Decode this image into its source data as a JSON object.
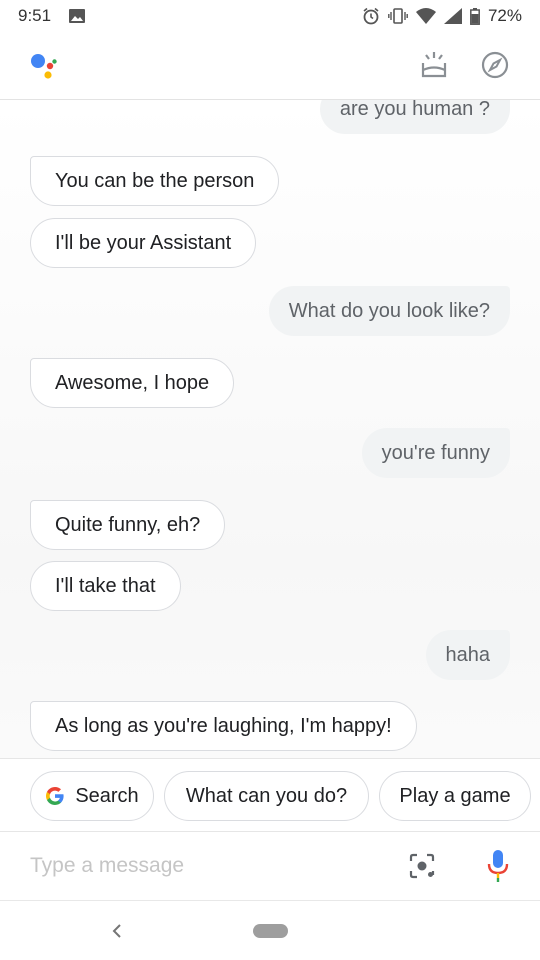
{
  "status_bar": {
    "time": "9:51",
    "battery": "72%",
    "icons": [
      "image-icon",
      "alarm-icon",
      "vibrate-icon",
      "wifi-icon",
      "signal-icon",
      "battery-icon"
    ]
  },
  "header": {
    "logo": "google-assistant-logo",
    "snapshot_icon": "snapshot-icon",
    "explore_icon": "compass-icon"
  },
  "messages": [
    {
      "role": "user",
      "text": "are you human ?"
    },
    {
      "role": "bot",
      "text": "You can be the person"
    },
    {
      "role": "bot",
      "text": "I'll be your Assistant"
    },
    {
      "role": "user",
      "text": "What do you look like?"
    },
    {
      "role": "bot",
      "text": "Awesome, I hope"
    },
    {
      "role": "user",
      "text": "you're funny"
    },
    {
      "role": "bot",
      "text": "Quite funny, eh?"
    },
    {
      "role": "bot",
      "text": "I'll take that"
    },
    {
      "role": "user",
      "text": "haha"
    },
    {
      "role": "bot",
      "text": "As long as you're laughing, I'm happy!"
    }
  ],
  "suggestions": [
    "Search",
    "What can you do?",
    "Play a game"
  ],
  "input": {
    "placeholder": "Type a message",
    "value": ""
  },
  "colors": {
    "google_blue": "#4285F4",
    "google_red": "#EA4335",
    "google_yellow": "#FBBC05",
    "google_green": "#34A853",
    "user_bubble": "#f1f3f4"
  }
}
